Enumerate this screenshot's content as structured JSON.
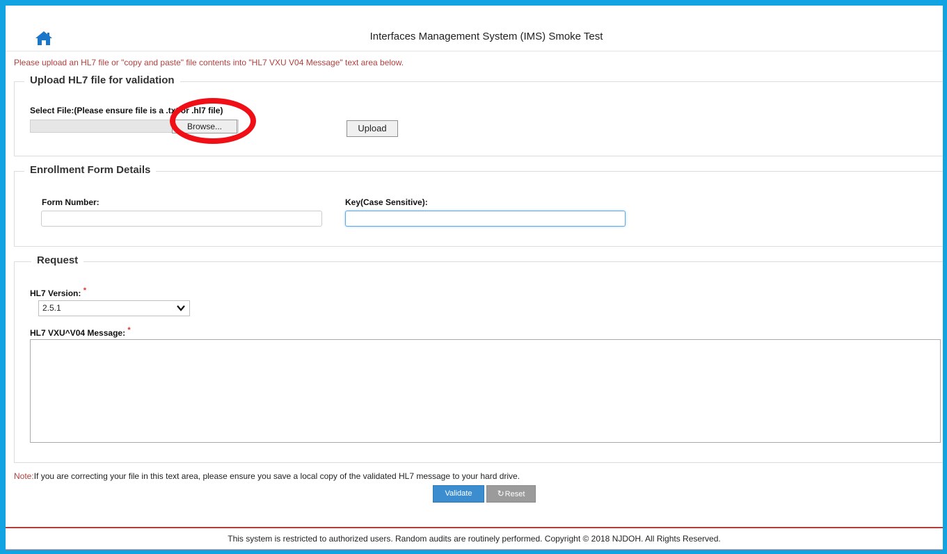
{
  "header": {
    "title": "Interfaces Management System (IMS) Smoke Test",
    "home_icon": "home-icon"
  },
  "instruction": "Please upload an HL7 file or \"copy and paste\" file contents into \"HL7 VXU V04 Message\" text area below.",
  "upload": {
    "legend": "Upload HL7 file for validation",
    "select_label": "Select File:(Please ensure file is a .txt or .hl7 file)",
    "browse_label": "Browse...",
    "upload_label": "Upload"
  },
  "enrollment": {
    "legend": "Enrollment Form Details",
    "form_number_label": "Form Number:",
    "form_number_value": "",
    "key_label": "Key(Case Sensitive):",
    "key_value": ""
  },
  "request": {
    "legend": "Request",
    "version_label": "HL7 Version:",
    "version_value": "2.5.1",
    "message_label": "HL7 VXU^V04 Message:",
    "message_value": "",
    "required_marker": "*"
  },
  "note": {
    "prefix": "Note:",
    "text": "If you are correcting your file in this text area, please ensure you save a local copy of the validated HL7 message to your hard drive."
  },
  "actions": {
    "validate_label": "Validate",
    "reset_label": "Reset",
    "reset_icon": "refresh-icon"
  },
  "footer": {
    "text": "This system is restricted to authorized users. Random audits are routinely performed. Copyright © 2018 NJDOH. All Rights Reserved."
  },
  "colors": {
    "frame_border": "#12a3e3",
    "home_icon": "#1a76c9",
    "instruction_text": "#b0413e",
    "highlight_circle": "#f00f16",
    "validate_button": "#3c8dd0",
    "reset_button": "#9b9b9b",
    "footer_rule": "#b43d3a"
  }
}
